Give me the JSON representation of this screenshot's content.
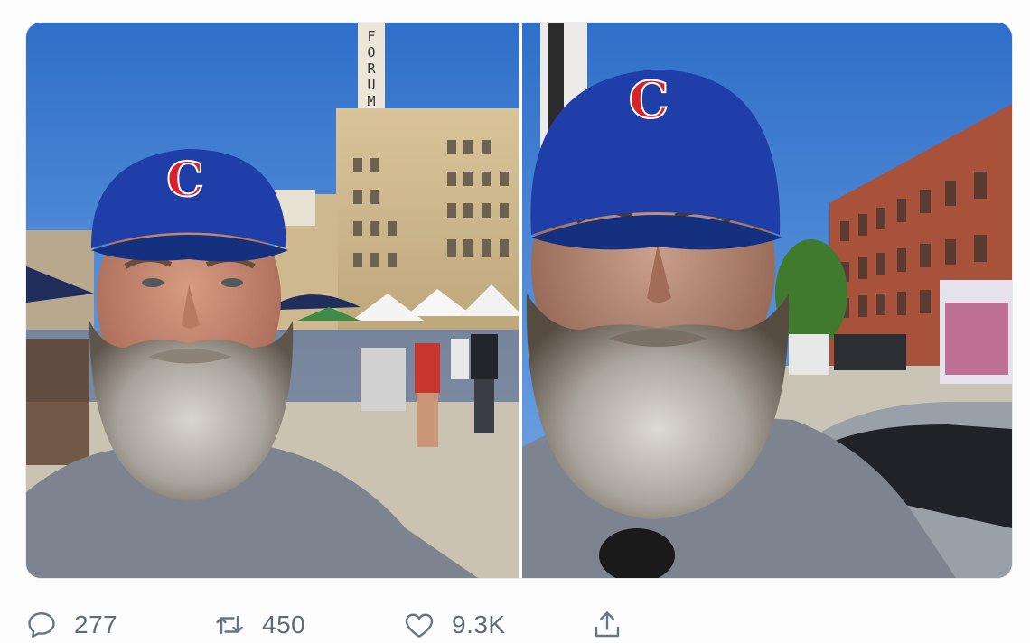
{
  "tweet": {
    "media": [
      {
        "alt": "",
        "scene": "farmers-market-selfie"
      },
      {
        "alt": "",
        "scene": "street-selfie"
      }
    ],
    "tower_sign": "FORUM",
    "actions": {
      "reply": {
        "icon": "reply-icon",
        "count": "277"
      },
      "retweet": {
        "icon": "retweet-icon",
        "count": "450"
      },
      "like": {
        "icon": "heart-icon",
        "count": "9.3K"
      },
      "share": {
        "icon": "share-icon"
      }
    }
  },
  "colors": {
    "sky": "#3f7fd6",
    "cap": "#1f3ea8",
    "cap_logo": "#d8232a",
    "shirt": "#7d8490",
    "beard": "#a9a6a0",
    "icon": "#657786"
  }
}
